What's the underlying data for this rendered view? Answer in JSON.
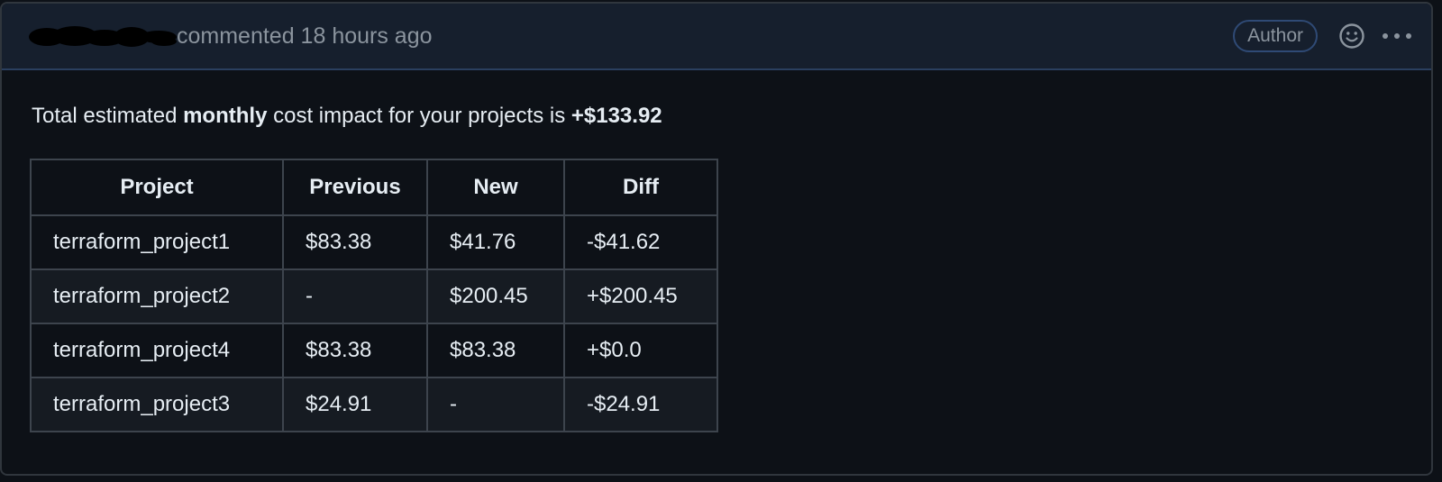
{
  "comment": {
    "meta": "commented 18 hours ago",
    "author_badge": "Author",
    "icons": {
      "reaction": "smiley-icon",
      "menu": "kebab-menu-icon"
    }
  },
  "summary": {
    "prefix": "Total estimated ",
    "emphasis": "monthly",
    "middle": " cost impact for your projects is ",
    "total": "+$133.92"
  },
  "table": {
    "headers": [
      "Project",
      "Previous",
      "New",
      "Diff"
    ],
    "rows": [
      [
        "terraform_project1",
        "$83.38",
        "$41.76",
        "-$41.62"
      ],
      [
        "terraform_project2",
        "-",
        "$200.45",
        "+$200.45"
      ],
      [
        "terraform_project4",
        "$83.38",
        "$83.38",
        "+$0.0"
      ],
      [
        "terraform_project3",
        "$24.91",
        "-",
        "-$24.91"
      ]
    ]
  },
  "colors": {
    "background": "#0d1117",
    "header_background": "#161f2d",
    "badge_border": "#2f4a75",
    "muted_text": "#8b949e",
    "text": "#e6edf3"
  }
}
